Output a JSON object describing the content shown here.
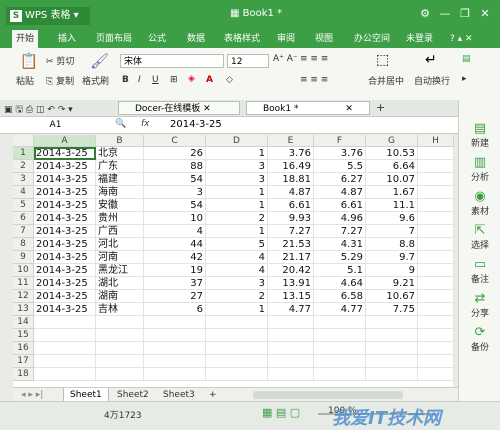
{
  "app": {
    "name": "WPS 表格",
    "doc_title": "Book1 *"
  },
  "menu": [
    "开始",
    "插入",
    "页面布局",
    "公式",
    "数据",
    "表格样式",
    "审阅",
    "视图",
    "办公空间"
  ],
  "account": "未登录",
  "ribbon": {
    "paste": "粘贴",
    "cut": "剪切",
    "copy": "复制",
    "format_painter": "格式刷",
    "font_name": "宋体",
    "font_size": "12",
    "merge_center": "合并居中",
    "wrap_text": "自动换行"
  },
  "tabs": [
    {
      "label": "Docer-在线模板"
    },
    {
      "label": "Book1 *"
    }
  ],
  "formula": {
    "cell_ref": "A1",
    "fx": "fx",
    "value": "2014-3-25"
  },
  "columns": [
    "A",
    "B",
    "C",
    "D",
    "E",
    "F",
    "G",
    "H"
  ],
  "row_numbers": [
    "1",
    "2",
    "3",
    "4",
    "5",
    "6",
    "7",
    "8",
    "9",
    "10",
    "11",
    "12",
    "13",
    "14",
    "15",
    "16",
    "17",
    "18"
  ],
  "rows": [
    [
      "2014-3-25",
      "北京",
      "26",
      "1",
      "3.76",
      "3.76",
      "10.53"
    ],
    [
      "2014-3-25",
      "广东",
      "88",
      "3",
      "16.49",
      "5.5",
      "6.64"
    ],
    [
      "2014-3-25",
      "福建",
      "54",
      "3",
      "18.81",
      "6.27",
      "10.07"
    ],
    [
      "2014-3-25",
      "海南",
      "3",
      "1",
      "4.87",
      "4.87",
      "1.67"
    ],
    [
      "2014-3-25",
      "安徽",
      "54",
      "1",
      "6.61",
      "6.61",
      "11.1"
    ],
    [
      "2014-3-25",
      "贵州",
      "10",
      "2",
      "9.93",
      "4.96",
      "9.6"
    ],
    [
      "2014-3-25",
      "广西",
      "4",
      "1",
      "7.27",
      "7.27",
      "7"
    ],
    [
      "2014-3-25",
      "河北",
      "44",
      "5",
      "21.53",
      "4.31",
      "8.8"
    ],
    [
      "2014-3-25",
      "河南",
      "42",
      "4",
      "21.17",
      "5.29",
      "9.7"
    ],
    [
      "2014-3-25",
      "黑龙江",
      "19",
      "4",
      "20.42",
      "5.1",
      "9"
    ],
    [
      "2014-3-25",
      "湖北",
      "37",
      "3",
      "13.91",
      "4.64",
      "9.21"
    ],
    [
      "2014-3-25",
      "湖南",
      "27",
      "2",
      "13.15",
      "6.58",
      "10.67"
    ],
    [
      "2014-3-25",
      "吉林",
      "6",
      "1",
      "4.77",
      "4.77",
      "7.75"
    ]
  ],
  "sidebar": [
    "新建",
    "分析",
    "素材",
    "选择",
    "备注",
    "分享",
    "备份"
  ],
  "sheets": [
    "Sheet1",
    "Sheet2",
    "Sheet3"
  ],
  "status": {
    "count": "4万1723",
    "zoom": "100 %"
  },
  "watermark": "我爱IT技术网",
  "colors": {
    "brand_green": "#3d9f45",
    "selection_green": "#2e7d32"
  }
}
